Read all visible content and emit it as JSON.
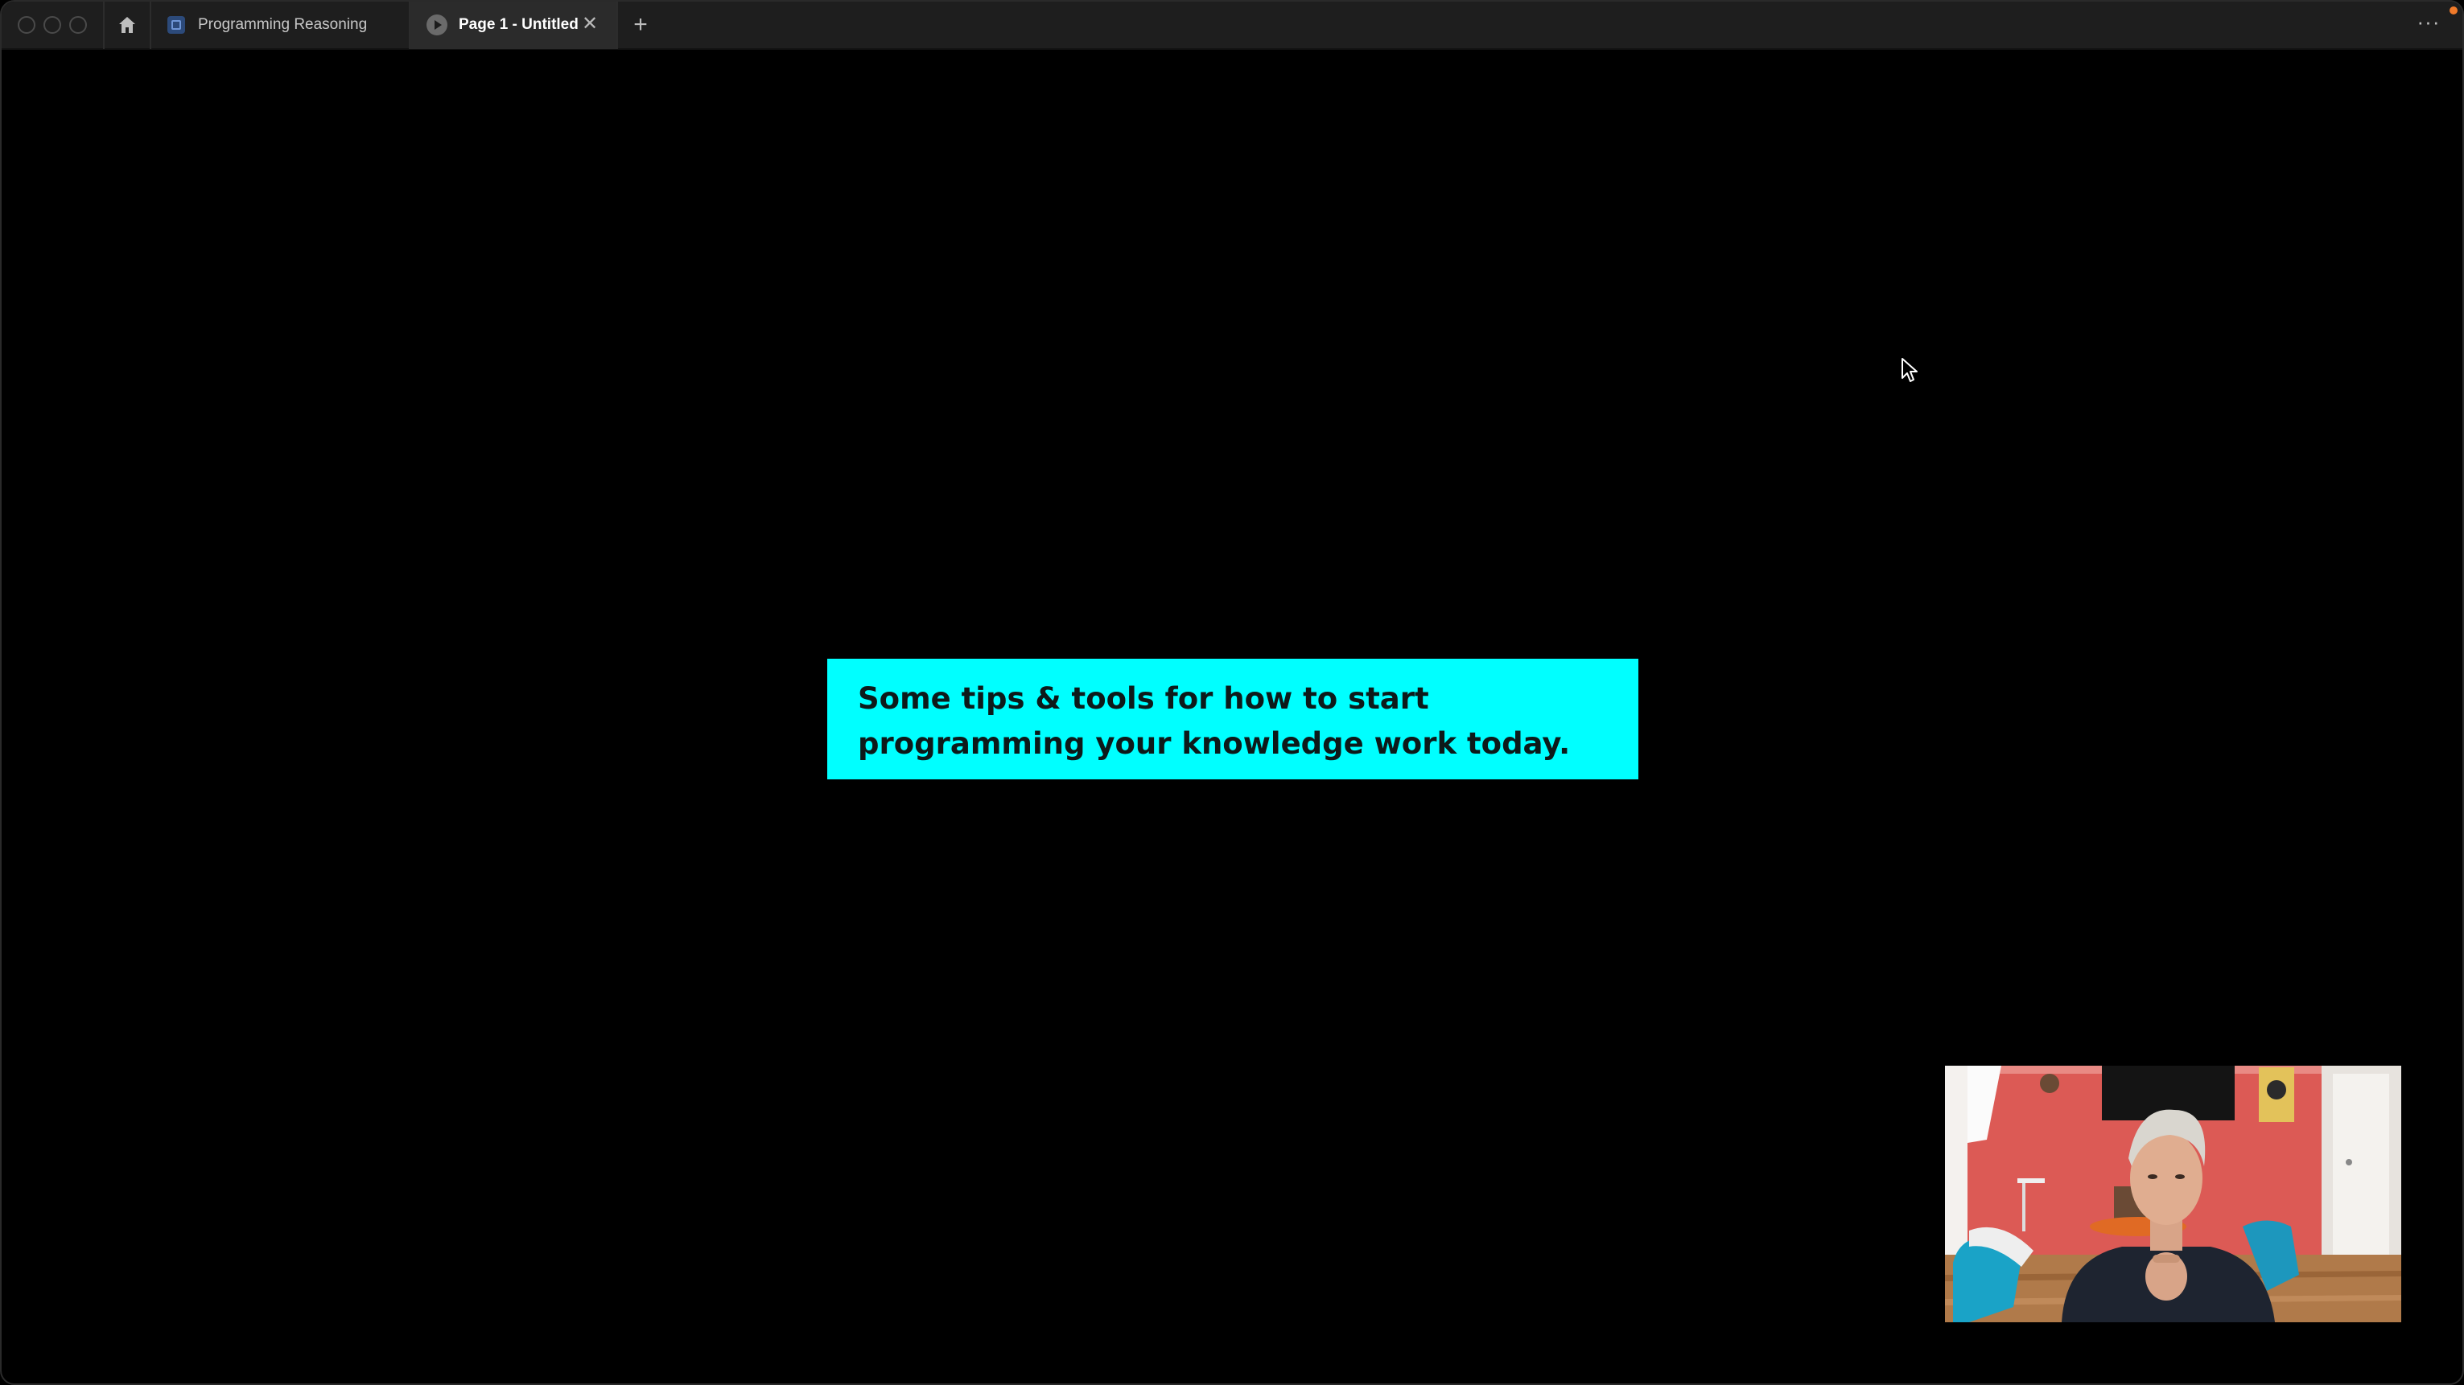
{
  "titlebar": {
    "tabs": [
      {
        "label": "Programming Reasoning",
        "active": false
      },
      {
        "label": "Page 1 - Untitled",
        "active": true
      }
    ],
    "new_tab_symbol": "+",
    "close_symbol": "✕",
    "more_symbol": "···"
  },
  "slide": {
    "caption_lines": [
      "Some tips & tools for how to start",
      "programming your knowledge work today."
    ],
    "caption_bg": "#00ffff"
  },
  "icons": {
    "home": "home-icon",
    "file": "file-icon",
    "present": "play-icon",
    "cursor": "mouse-cursor-icon"
  },
  "colors": {
    "titlebar": "#1e1e1e",
    "canvas": "#000000",
    "accent_dot": "#f07a2a"
  }
}
